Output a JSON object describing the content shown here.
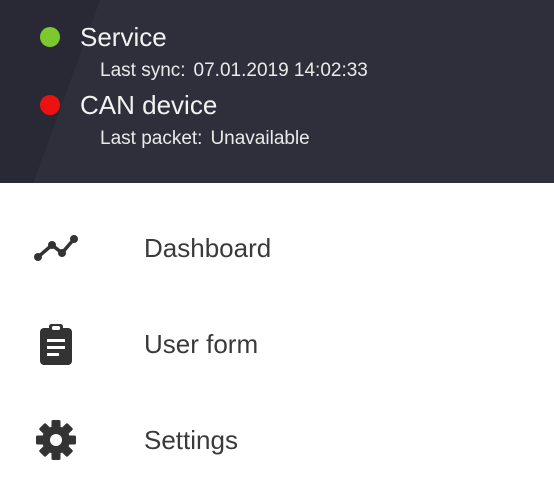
{
  "header": {
    "service": {
      "title": "Service",
      "status_color": "#7cc82f",
      "sub_label": "Last sync:",
      "sub_value": "07.01.2019 14:02:33"
    },
    "can_device": {
      "title": "CAN device",
      "status_color": "#ee1111",
      "sub_label": "Last packet:",
      "sub_value": "Unavailable"
    },
    "background_color": "#2e2f3b"
  },
  "menu": {
    "items": [
      {
        "label": "Dashboard",
        "icon": "timeline-icon"
      },
      {
        "label": "User form",
        "icon": "clipboard-icon"
      },
      {
        "label": "Settings",
        "icon": "gear-icon"
      }
    ],
    "icon_color": "#333333"
  }
}
